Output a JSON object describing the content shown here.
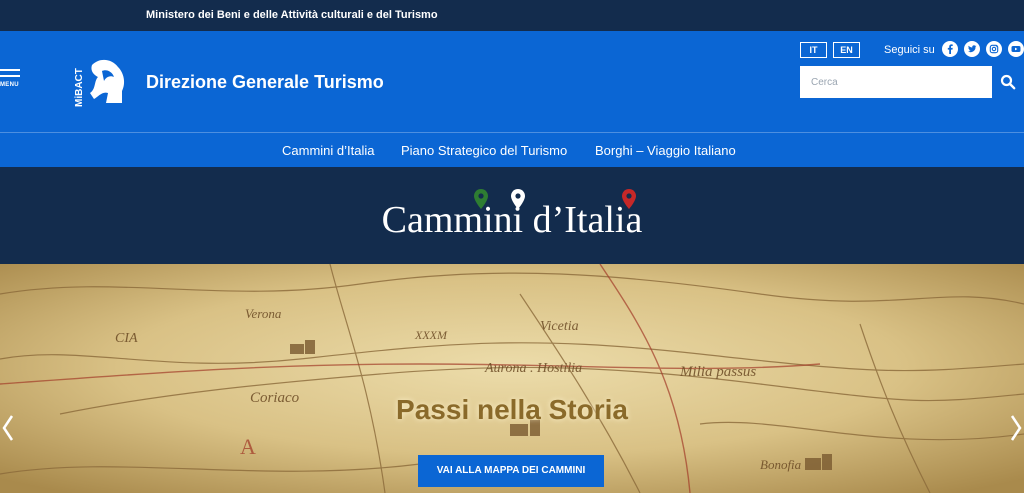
{
  "top_bar": {
    "ministry": "Ministero dei Beni e delle Attività culturali e del Turismo"
  },
  "header": {
    "menu_label": "MENU",
    "logo_text": "MiBACT",
    "title": "Direzione Generale Turismo",
    "languages": [
      "IT",
      "EN"
    ],
    "follow_label": "Seguici su",
    "social": [
      "facebook-icon",
      "twitter-icon",
      "instagram-icon",
      "youtube-icon"
    ],
    "search": {
      "placeholder": "Cerca"
    }
  },
  "nav": {
    "items": [
      "Cammini d’Italia",
      "Piano Strategico del Turismo",
      "Borghi – Viaggio Italiano"
    ]
  },
  "banner": {
    "title": "Cammini d’Italia",
    "pin_colors": [
      "#2e7d32",
      "#ffffff",
      "#c62828"
    ]
  },
  "hero": {
    "title": "Passi nella Storia",
    "button_label": "VAI ALLA MAPPA DEI CAMMINI",
    "map_words": [
      "Verona",
      "Vicetia",
      "Aurona . Hostilia",
      "Milia passus",
      "Coriaco",
      "XXXM",
      "CIA",
      "Bonofia"
    ]
  },
  "colors": {
    "dark_navy": "#132c4d",
    "brand_blue": "#0b66d4",
    "parchment": "#d4bc7e"
  }
}
